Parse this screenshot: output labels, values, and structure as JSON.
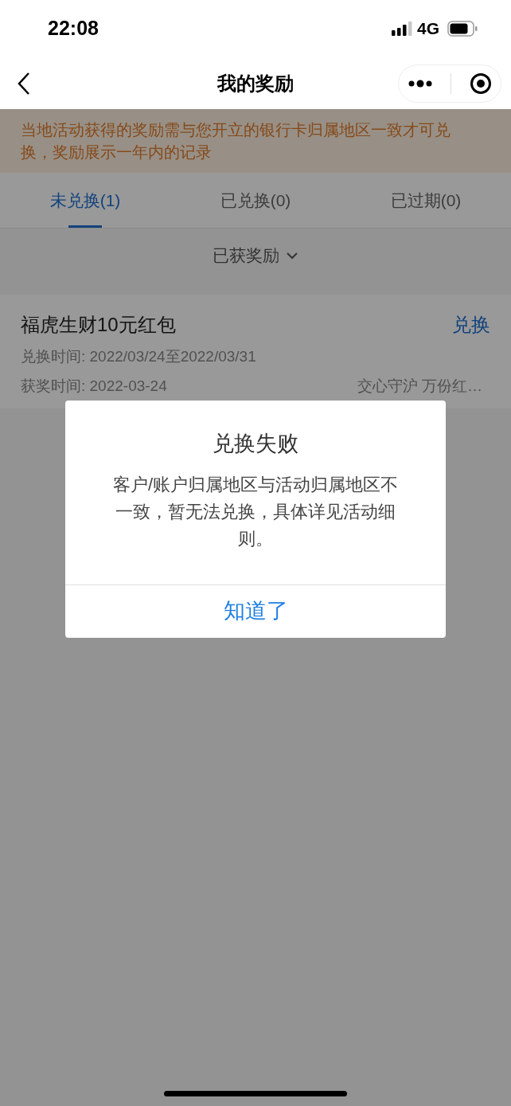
{
  "status_bar": {
    "time": "22:08",
    "network": "4G"
  },
  "nav": {
    "title": "我的奖励"
  },
  "notice": "当地活动获得的奖励需与您开立的银行卡归属地区一致才可兑换，奖励展示一年内的记录",
  "tabs": [
    {
      "label": "未兑换(1)",
      "selected": true
    },
    {
      "label": "已兑换(0)",
      "selected": false
    },
    {
      "label": "已过期(0)",
      "selected": false
    }
  ],
  "filter": {
    "label": "已获奖励"
  },
  "rewards": [
    {
      "title": "福虎生财10元红包",
      "action": "兑换",
      "redeem_period": "兑换时间: 2022/03/24至2022/03/31",
      "award_date": "获奖时间: 2022-03-24",
      "activity": "交心守沪 万份红…"
    }
  ],
  "dialog": {
    "title": "兑换失败",
    "message": "客户/账户归属地区与活动归属地区不一致，暂无法兑换，具体详见活动细则。",
    "button": "知道了"
  }
}
